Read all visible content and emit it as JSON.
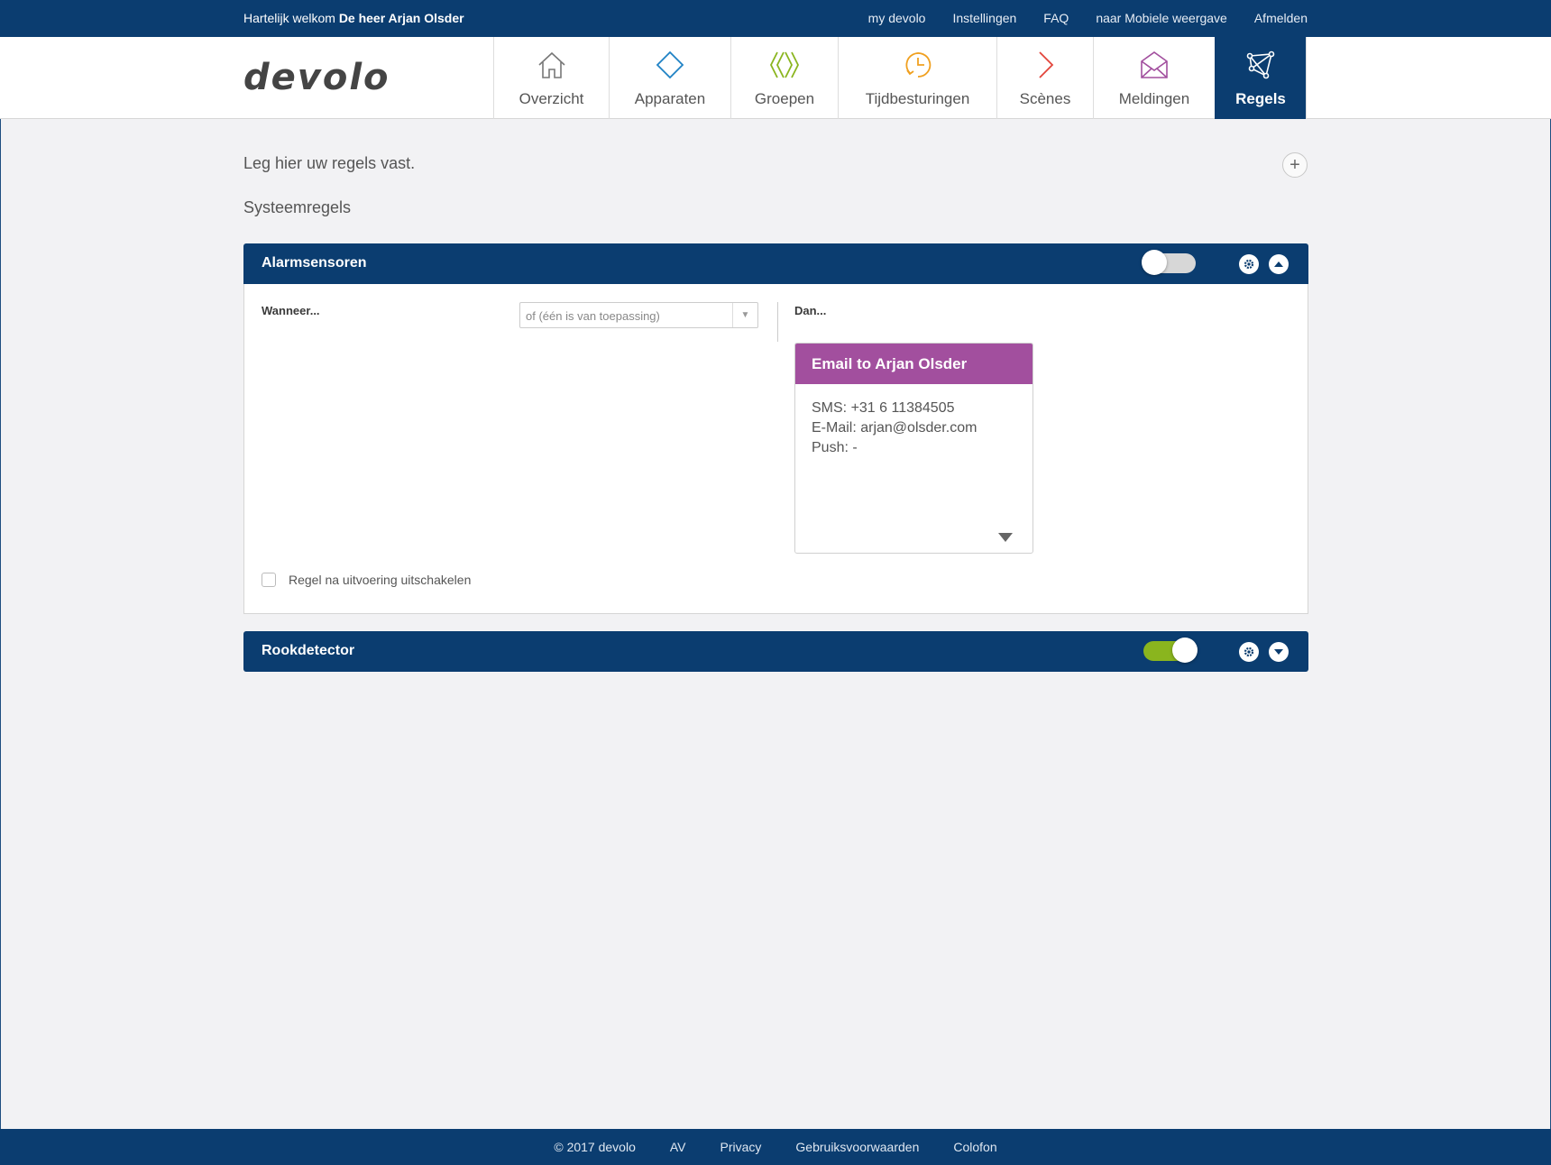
{
  "topbar": {
    "welcome_prefix": "Hartelijk welkom",
    "welcome_name": "De heer Arjan Olsder",
    "links": [
      "my devolo",
      "Instellingen",
      "FAQ",
      "naar Mobiele weergave",
      "Afmelden"
    ]
  },
  "header": {
    "logo": "devolo",
    "nav": [
      {
        "label": "Overzicht",
        "icon": "home-icon",
        "color": "#777777"
      },
      {
        "label": "Apparaten",
        "icon": "diamond-icon",
        "color": "#1f82c5"
      },
      {
        "label": "Groepen",
        "icon": "groups-icon",
        "color": "#8ab51e"
      },
      {
        "label": "Tijdbesturingen",
        "icon": "clock-icon",
        "color": "#f0a020"
      },
      {
        "label": "Scènes",
        "icon": "play-icon",
        "color": "#e2443a"
      },
      {
        "label": "Meldingen",
        "icon": "envelope-icon",
        "color": "#a24f9e"
      },
      {
        "label": "Regels",
        "icon": "network-icon",
        "color": "#ffffff",
        "active": true
      }
    ]
  },
  "content": {
    "intro": "Leg hier uw regels vast.",
    "section_title": "Systeemregels",
    "rules": [
      {
        "title": "Alarmsensoren",
        "enabled": false,
        "expanded": true,
        "when_label": "Wanneer...",
        "condition_select": "of (één is van toepassing)",
        "then_label": "Dan...",
        "action_card": {
          "title": "Email to Arjan Olsder",
          "lines": [
            "SMS: +31 6 11384505",
            "E-Mail: arjan@olsder.com",
            "Push: -"
          ]
        },
        "disable_after_label": "Regel na uitvoering uitschakelen"
      },
      {
        "title": "Rookdetector",
        "enabled": true,
        "expanded": false
      }
    ]
  },
  "footer": {
    "links": [
      "© 2017 devolo",
      "AV",
      "Privacy",
      "Gebruiksvoorwaarden",
      "Colofon"
    ]
  }
}
